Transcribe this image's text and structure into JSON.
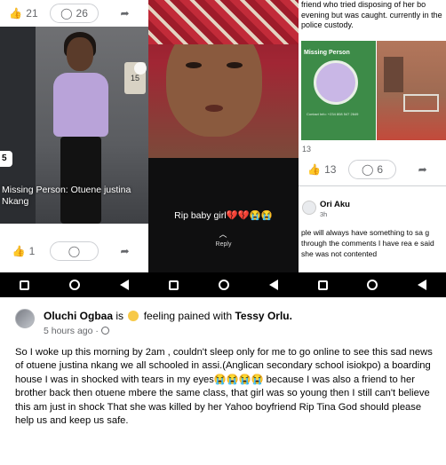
{
  "panel1": {
    "reactions": {
      "like_count": "21",
      "comment_count": "26"
    },
    "house_number": "15",
    "side_badge": "5",
    "caption": "Missing Person: Otuene justina Nkang",
    "footer": {
      "like_count": "1"
    }
  },
  "panel2": {
    "story_caption": "Rip baby girl💔💔😭😭",
    "reply_label": "Reply"
  },
  "panel3": {
    "news_text": "friend who tried disposing of her bo evening but was caught. currently in the police custody.",
    "image_title": "Missing Person",
    "small_print": "Contact Info: +234 808 547 2649",
    "count_13": "13",
    "like_count": "13",
    "comment_count": "6",
    "commenter": "Ori Aku",
    "comment_time": "3h",
    "comment_text": "ple will always have something to sa g through the comments I have rea e said she was not contented"
  },
  "post": {
    "author": "Oluchi Ogbaa",
    "verb_is": "is",
    "feeling": "feeling pained with",
    "tagged": "Tessy Orlu.",
    "time": "5 hours ago",
    "body": "So I woke up this morning by 2am , couldn't sleep only for me to go online to see this sad news of otuene justina nkang we all schooled in assi.(Anglican secondary school isiokpo) a boarding house I was in shocked with tears in my eyes😭😭😭😭 because I was also a friend to her brother back then otuene mbere the same class, that girl was so young then I still can't believe this am just in shock That she was killed by her Yahoo boyfriend Rip Tina God should please help us and keep us safe."
  },
  "icons": [
    "like-icon",
    "comment-icon",
    "share-icon",
    "recent-apps-icon",
    "home-icon",
    "back-icon",
    "globe-icon",
    "feeling-emoji-icon"
  ],
  "colors": {
    "text": "#050505",
    "secondary": "#65676b",
    "missing_green": "#3d8b48",
    "scarf_red": "#c22b39"
  }
}
